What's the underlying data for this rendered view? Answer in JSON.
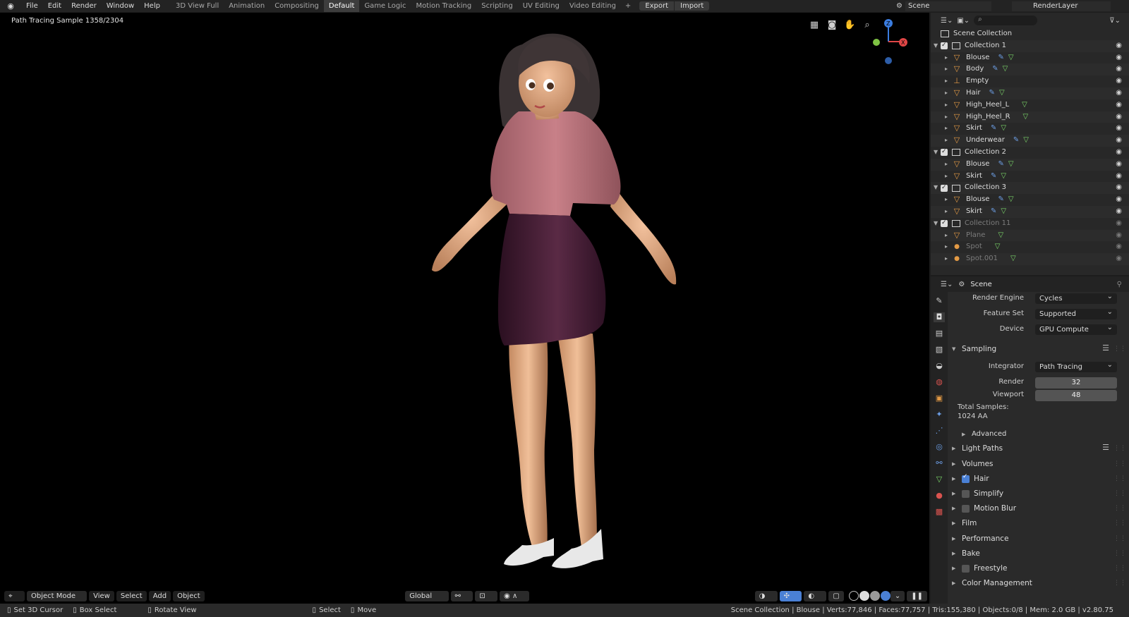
{
  "topbar": {
    "menu": [
      "File",
      "Edit",
      "Render",
      "Window",
      "Help"
    ],
    "tabs": [
      "3D View Full",
      "Animation",
      "Compositing",
      "Default",
      "Game Logic",
      "Motion Tracking",
      "Scripting",
      "UV Editing",
      "Video Editing"
    ],
    "active_tab": "Default",
    "export_label": "Export",
    "import_label": "Import",
    "scene": "Scene",
    "render_layer": "RenderLayer"
  },
  "viewport": {
    "info": "Path Tracing Sample 1358/2304",
    "mode": "Object Mode",
    "menus": [
      "View",
      "Select",
      "Add",
      "Object"
    ],
    "orientation": "Global"
  },
  "outliner": {
    "root": "Scene Collection",
    "rows": [
      {
        "label": "Collection 1",
        "kind": "collection",
        "dim": false
      },
      {
        "label": "Blouse",
        "kind": "mesh",
        "mods": true,
        "dim": false
      },
      {
        "label": "Body",
        "kind": "mesh",
        "mods": true,
        "dim": false
      },
      {
        "label": "Empty",
        "kind": "empty",
        "mods": false,
        "dim": false
      },
      {
        "label": "Hair",
        "kind": "mesh",
        "mods": true,
        "dim": false
      },
      {
        "label": "High_Heel_L",
        "kind": "mesh",
        "mods": false,
        "dim": false
      },
      {
        "label": "High_Heel_R",
        "kind": "mesh",
        "mods": false,
        "dim": false
      },
      {
        "label": "Skirt",
        "kind": "mesh",
        "mods": true,
        "dim": false
      },
      {
        "label": "Underwear",
        "kind": "mesh",
        "mods": true,
        "dim": false
      },
      {
        "label": "Collection 2",
        "kind": "collection",
        "dim": false
      },
      {
        "label": "Blouse",
        "kind": "mesh",
        "mods": true,
        "dim": false
      },
      {
        "label": "Skirt",
        "kind": "mesh",
        "mods": true,
        "dim": false
      },
      {
        "label": "Collection 3",
        "kind": "collection",
        "dim": false
      },
      {
        "label": "Blouse",
        "kind": "mesh",
        "mods": true,
        "dim": false
      },
      {
        "label": "Skirt",
        "kind": "mesh",
        "mods": true,
        "dim": false
      },
      {
        "label": "Collection 11",
        "kind": "collection",
        "dim": true
      },
      {
        "label": "Plane",
        "kind": "mesh",
        "mods": false,
        "dim": true
      },
      {
        "label": "Spot",
        "kind": "lamp",
        "mods": false,
        "dim": true
      },
      {
        "label": "Spot.001",
        "kind": "lamp",
        "mods": false,
        "dim": true
      }
    ]
  },
  "properties": {
    "context": "Scene",
    "render_engine_label": "Render Engine",
    "render_engine": "Cycles",
    "feature_set_label": "Feature Set",
    "feature_set": "Supported",
    "device_label": "Device",
    "device": "GPU Compute",
    "sampling_label": "Sampling",
    "integrator_label": "Integrator",
    "integrator": "Path Tracing",
    "render_label": "Render",
    "render_samples": "32",
    "viewport_label": "Viewport",
    "viewport_samples": "48",
    "total_samples_label": "Total Samples:",
    "total_samples": "1024 AA",
    "advanced_label": "Advanced",
    "panels": [
      {
        "label": "Light Paths",
        "checkbox": null,
        "list": true
      },
      {
        "label": "Volumes",
        "checkbox": null,
        "list": false
      },
      {
        "label": "Hair",
        "checkbox": true,
        "list": false
      },
      {
        "label": "Simplify",
        "checkbox": false,
        "list": false
      },
      {
        "label": "Motion Blur",
        "checkbox": false,
        "list": false
      },
      {
        "label": "Film",
        "checkbox": null,
        "list": false
      },
      {
        "label": "Performance",
        "checkbox": null,
        "list": false
      },
      {
        "label": "Bake",
        "checkbox": null,
        "list": false
      },
      {
        "label": "Freestyle",
        "checkbox": false,
        "list": false
      },
      {
        "label": "Color Management",
        "checkbox": null,
        "list": false
      }
    ]
  },
  "statusbar": {
    "set_cursor": "Set 3D Cursor",
    "box_select": "Box Select",
    "rotate_view": "Rotate View",
    "select": "Select",
    "move": "Move",
    "stats": "Scene Collection | Blouse | Verts:77,846 | Faces:77,757 | Tris:155,380 | Objects:0/8 | Mem: 2.0 GB | v2.80.75"
  },
  "colors": {
    "accent": "#4a80d5",
    "object_orange": "#e39a45",
    "mesh_green": "#7cd86a",
    "modifier_blue": "#6d9fe6"
  }
}
